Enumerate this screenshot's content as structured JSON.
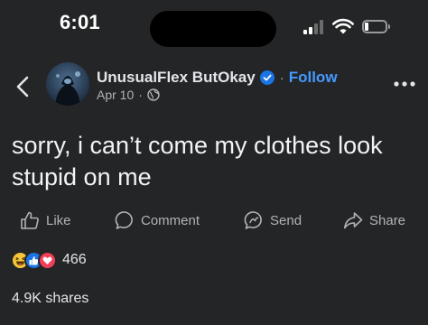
{
  "status_bar": {
    "time": "6:01"
  },
  "post": {
    "author": "UnusualFlex ButOkay",
    "follow_label": "Follow",
    "date": "Apr 10",
    "privacy_icon": "globe-icon",
    "text": "sorry, i can’t come my clothes look stupid on me"
  },
  "actions": {
    "like_label": "Like",
    "comment_label": "Comment",
    "send_label": "Send",
    "share_label": "Share"
  },
  "engagement": {
    "reaction_icons": [
      "haha-emoji-icon",
      "like-reaction-icon",
      "love-reaction-icon"
    ],
    "reaction_count": "466",
    "shares": "4.9K shares"
  },
  "colors": {
    "background": "#242526",
    "accent": "#4599ff",
    "secondary_text": "#b0b3b8"
  }
}
